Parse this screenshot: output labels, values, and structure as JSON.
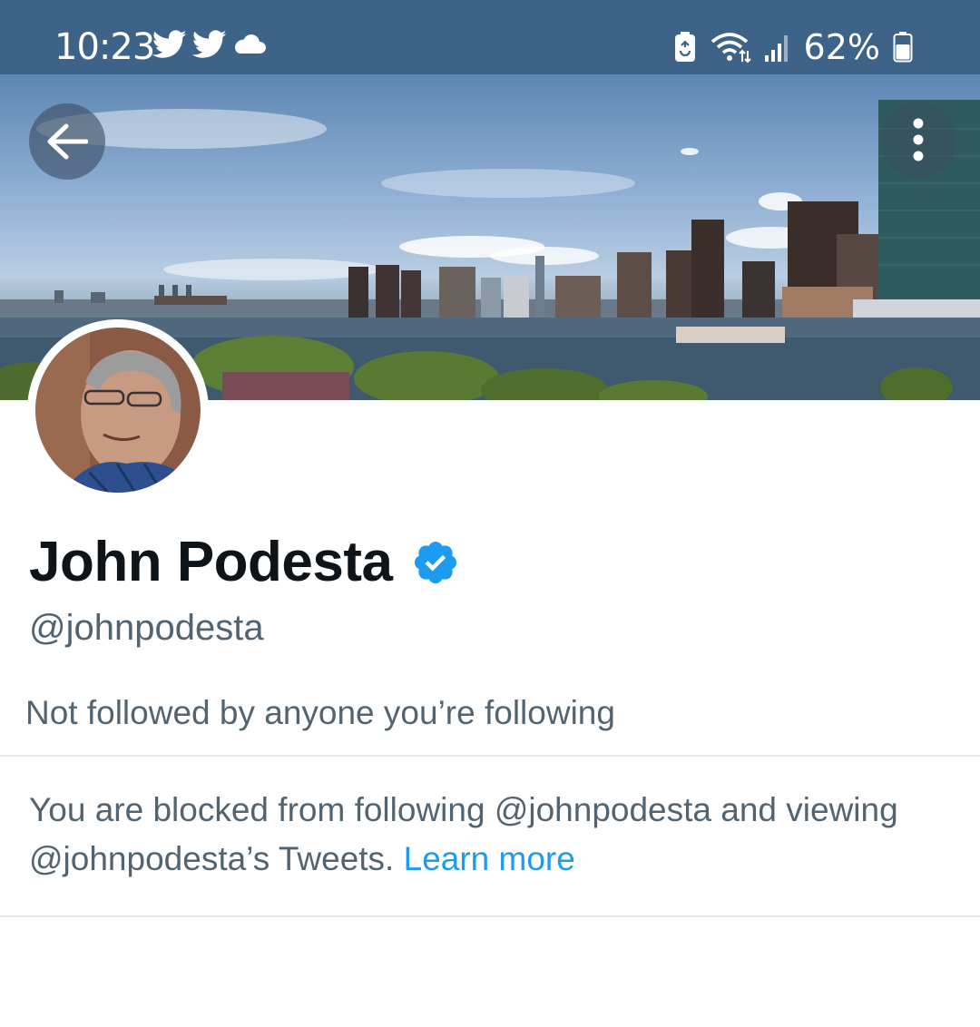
{
  "status_bar": {
    "time": "10:23",
    "battery_percent": "62%",
    "left_icons": [
      "twitter-icon",
      "twitter-icon",
      "cloud-icon"
    ],
    "right_icons": [
      "battery-saver-icon",
      "wifi-icon",
      "signal-icon",
      "battery-icon"
    ],
    "background_color": "#3d6389"
  },
  "header": {
    "back_icon": "arrow-left-icon",
    "more_icon": "more-vertical-icon"
  },
  "profile": {
    "display_name": "John Podesta",
    "verified": true,
    "verified_color": "#1d9bf0",
    "handle": "@johnpodesta",
    "followed_by": "Not followed by anyone you’re following"
  },
  "blocked_notice": {
    "message": "You are blocked from following @johnpodesta and viewing @johnpodesta’s Tweets.",
    "link_label": "Learn more",
    "link_color": "#1d9bf0"
  }
}
